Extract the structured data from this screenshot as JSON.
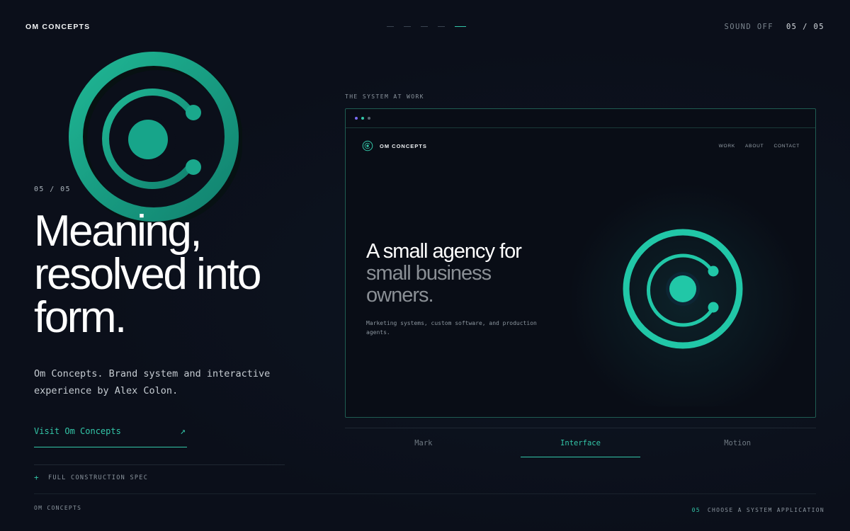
{
  "header": {
    "brand": "OM CONCEPTS",
    "sound": "SOUND OFF",
    "counter": "05 / 05",
    "progress_total": 5,
    "progress_active": 5
  },
  "hero": {
    "counter": "05 / 05",
    "headline_lines": [
      "Meaning,",
      "resolved into",
      "form."
    ],
    "description": "Om Concepts. Brand system and interactive experience by Alex Colon.",
    "visit_label": "Visit Om Concepts",
    "visit_arrow": "↗",
    "spec_plus": "+",
    "spec_label": "FULL CONSTRUCTION SPEC"
  },
  "showcase": {
    "label": "THE SYSTEM AT WORK",
    "browser_dots": [
      "#7b6cf6",
      "#33c6a8",
      "#5a6470"
    ],
    "inner": {
      "brand": "OM CONCEPTS",
      "nav": [
        "WORK",
        "ABOUT",
        "CONTACT"
      ],
      "headline_line1": "A small agency for",
      "headline_line2": "small business",
      "headline_line3": "owners.",
      "subtext": "Marketing systems, custom software, and production agents."
    },
    "tabs": [
      {
        "label": "Mark",
        "active": false
      },
      {
        "label": "Interface",
        "active": true
      },
      {
        "label": "Motion",
        "active": false
      }
    ]
  },
  "footer": {
    "brand": "OM CONCEPTS",
    "number": "05",
    "cta": "CHOOSE A SYSTEM APPLICATION"
  },
  "colors": {
    "accent": "#33c6a8",
    "background": "#0b0f1a",
    "logo_teal": "#1aa88c"
  }
}
